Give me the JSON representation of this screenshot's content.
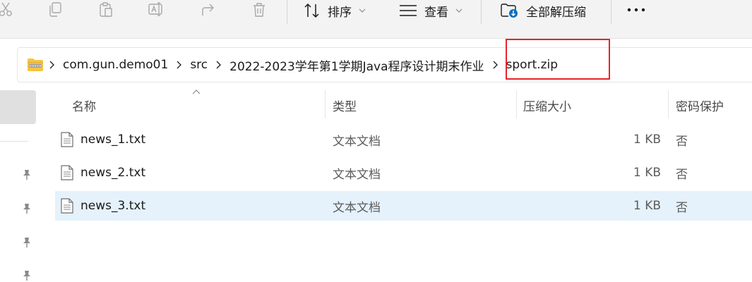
{
  "toolbar": {
    "actions": [
      {
        "icon": "cut-icon"
      },
      {
        "icon": "copy-icon"
      },
      {
        "icon": "paste-icon"
      },
      {
        "icon": "rename-icon"
      },
      {
        "icon": "share-icon"
      },
      {
        "icon": "delete-icon"
      }
    ],
    "sort_label": "排序",
    "view_label": "查看",
    "extract_all_label": "全部解压缩",
    "more_icon": "more-icon"
  },
  "address": {
    "crumbs": [
      "com.gun.demo01",
      "src",
      "2022-2023学年第1学期Java程序设计期末作业",
      "sport.zip"
    ],
    "highlighted_crumb": "sport.zip",
    "highlight_color": "#e8242b"
  },
  "columns": {
    "name": "名称",
    "type": "类型",
    "compressed_size": "压缩大小",
    "password_protected": "密码保护"
  },
  "files": [
    {
      "name": "news_1.txt",
      "type": "文本文档",
      "size": "1 KB",
      "protected": "否",
      "selected": false
    },
    {
      "name": "news_2.txt",
      "type": "文本文档",
      "size": "1 KB",
      "protected": "否",
      "selected": false
    },
    {
      "name": "news_3.txt",
      "type": "文本文档",
      "size": "1 KB",
      "protected": "否",
      "selected": true
    }
  ],
  "colors": {
    "selected_row": "#e5f1fb",
    "toolbar_bg": "#f3f3f3"
  }
}
